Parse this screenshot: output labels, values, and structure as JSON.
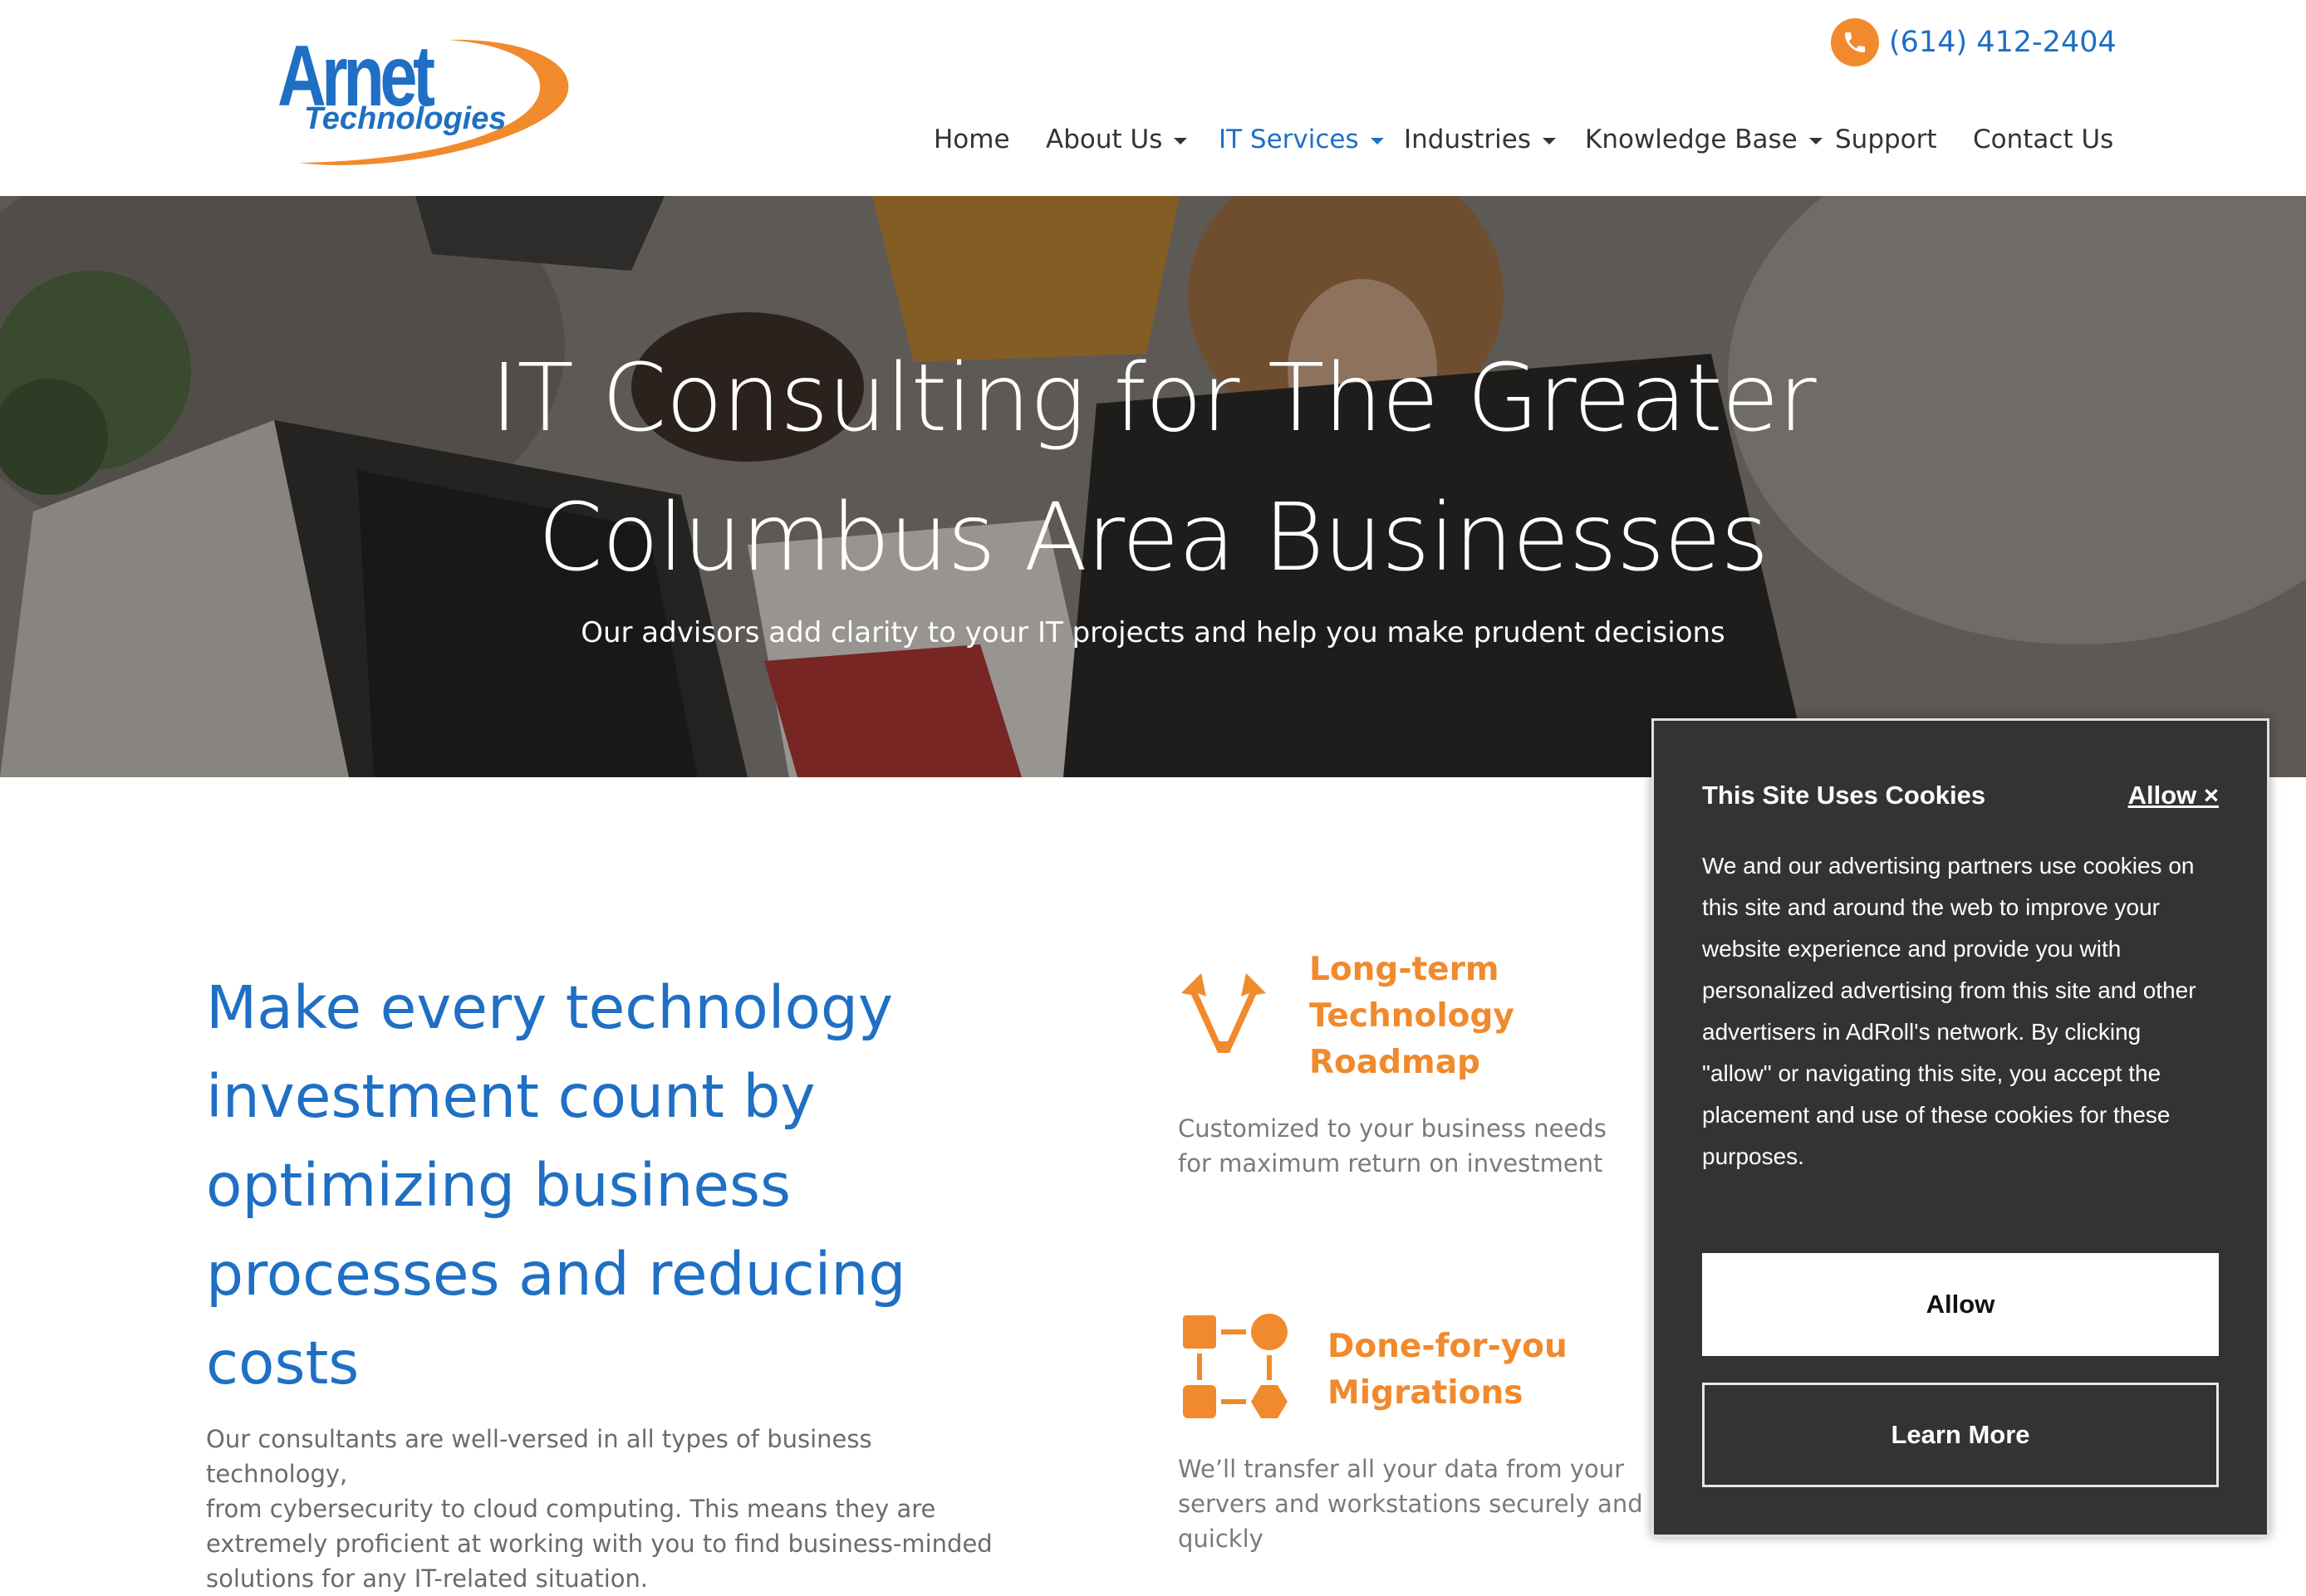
{
  "brand": {
    "logo_word": "Arnet",
    "logo_sub": "Technologies",
    "primary_color": "#1f6fc4",
    "accent_color": "#f08a2c"
  },
  "header": {
    "phone": "(614) 412-2404",
    "phone_icon": "phone-icon"
  },
  "nav": {
    "items": [
      {
        "label": "Home",
        "dropdown": false,
        "active": false
      },
      {
        "label": "About Us",
        "dropdown": true,
        "active": false
      },
      {
        "label": "IT Services",
        "dropdown": true,
        "active": true
      },
      {
        "label": "Industries",
        "dropdown": true,
        "active": false
      },
      {
        "label": "Knowledge Base",
        "dropdown": true,
        "active": false
      },
      {
        "label": "Support",
        "dropdown": false,
        "active": false
      },
      {
        "label": "Contact Us",
        "dropdown": false,
        "active": false
      }
    ]
  },
  "hero": {
    "title_line1": "IT Consulting for The Greater",
    "title_line2": "Columbus Area Businesses",
    "subtitle": "Our advisors add clarity to your IT projects and help you make prudent decisions"
  },
  "main": {
    "heading_lines": [
      "Make every technology",
      "investment count by",
      "optimizing business",
      "processes and reducing",
      "costs"
    ],
    "paragraph_lines": [
      "Our consultants are well-versed in all types of business technology,",
      "from cybersecurity to cloud computing. This means they are",
      "extremely proficient at working with you to find business-minded",
      "solutions for any IT-related situation."
    ]
  },
  "features": [
    {
      "icon": "roadmap-arrows-icon",
      "title_lines": [
        "Long-term",
        "Technology",
        "Roadmap"
      ],
      "text_lines": [
        "Customized to your business needs",
        "for maximum return on investment"
      ]
    },
    {
      "icon": "migration-flow-icon",
      "title_lines": [
        "Done-for-you",
        "Migrations"
      ],
      "text_lines": [
        "We’ll transfer all your data from your",
        "servers and workstations securely and",
        "quickly"
      ]
    }
  ],
  "cookie": {
    "title": "This Site Uses Cookies",
    "close_label": "Allow ×",
    "body_lines": [
      "We and our advertising partners use cookies on",
      "this site and around the web to improve your",
      "website experience and provide you with",
      "personalized advertising from this site and other",
      "advertisers in AdRoll's network. By clicking",
      "\"allow\" or navigating this site, you accept the",
      "placement and use of these cookies for these",
      "purposes."
    ],
    "allow_label": "Allow",
    "learn_label": "Learn More"
  }
}
